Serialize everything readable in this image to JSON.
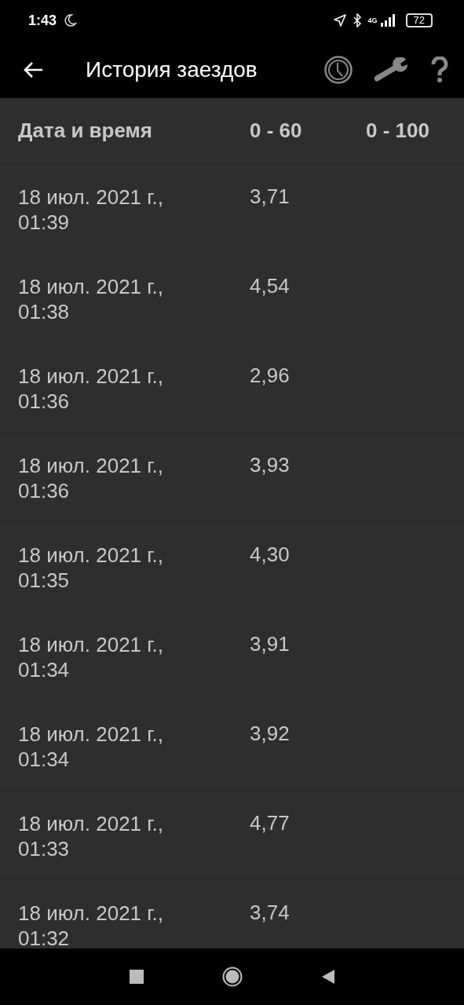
{
  "status_bar": {
    "time": "1:43",
    "battery": "72",
    "network": "4G"
  },
  "toolbar": {
    "title": "История заездов"
  },
  "table": {
    "columns": [
      "Дата и время",
      "0 - 60",
      "0 - 100"
    ],
    "rows": [
      {
        "date": "18 июл. 2021 г., 01:39",
        "t60": "3,71"
      },
      {
        "date": "18 июл. 2021 г., 01:38",
        "t60": "4,54"
      },
      {
        "date": "18 июл. 2021 г., 01:36",
        "t60": "2,96"
      },
      {
        "date": "18 июл. 2021 г., 01:36",
        "t60": "3,93"
      },
      {
        "date": "18 июл. 2021 г., 01:35",
        "t60": "4,30"
      },
      {
        "date": "18 июл. 2021 г., 01:34",
        "t60": "3,91"
      },
      {
        "date": "18 июл. 2021 г., 01:34",
        "t60": "3,92"
      },
      {
        "date": "18 июл. 2021 г., 01:33",
        "t60": "4,77"
      },
      {
        "date": "18 июл. 2021 г., 01:32",
        "t60": "3,74"
      }
    ]
  }
}
